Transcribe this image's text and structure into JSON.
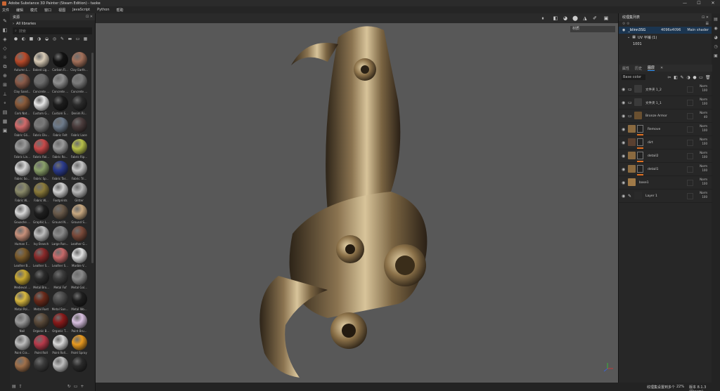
{
  "window": {
    "title": "Adobe Substance 3D Painter (Steam Edition) - taoke",
    "min": "—",
    "max": "☐",
    "close": "✕"
  },
  "menu": [
    "文件",
    "编辑",
    "模式",
    "窗口",
    "视图",
    "JavaScript",
    "Python",
    "帮助"
  ],
  "assets": {
    "title": "资源",
    "library": "All libraries",
    "search_placeholder": "搜索",
    "materials": [
      {
        "name": "Autumn L...",
        "color": "#b84a2a"
      },
      {
        "name": "Baked Lig...",
        "color": "#d8cbb6"
      },
      {
        "name": "Carbon Fi...",
        "color": "#121212"
      },
      {
        "name": "Clay Earth...",
        "color": "#a3705a"
      },
      {
        "name": "Clay Sand...",
        "color": "#8a5a48"
      },
      {
        "name": "Concrete ...",
        "color": "#6c6c6c"
      },
      {
        "name": "Concrete ...",
        "color": "#8f8f8f"
      },
      {
        "name": "Concrete ...",
        "color": "#7b7b7b"
      },
      {
        "name": "Cork Nat...",
        "color": "#8a5a3a"
      },
      {
        "name": "Custom G...",
        "color": "#e6e6e6"
      },
      {
        "name": "Custom S...",
        "color": "#1c1c1c"
      },
      {
        "name": "Denim Ri...",
        "color": "#2a2a2a"
      },
      {
        "name": "Fabric Gli...",
        "color": "#d26a6a"
      },
      {
        "name": "Fabric Div...",
        "color": "#7a7a7a"
      },
      {
        "name": "Fabric Felt",
        "color": "#6e7b8b"
      },
      {
        "name": "Fabric Lace",
        "color": "#4a3c3c"
      },
      {
        "name": "Fabric Lin...",
        "color": "#9a9a9a"
      },
      {
        "name": "Fabric Rol...",
        "color": "#c84a4a"
      },
      {
        "name": "Fabric Ro...",
        "color": "#9a9a9a"
      },
      {
        "name": "Fabric Rip...",
        "color": "#b8c04a"
      },
      {
        "name": "Fabric So...",
        "color": "#d6d6d6"
      },
      {
        "name": "Fabric Sp...",
        "color": "#8aa06a"
      },
      {
        "name": "Fabric Tar...",
        "color": "#2a3a8a"
      },
      {
        "name": "Fabric Tri...",
        "color": "#c6c6c6"
      },
      {
        "name": "Fabric W...",
        "color": "#8a8a6a"
      },
      {
        "name": "Fabric W...",
        "color": "#8a7a3a"
      },
      {
        "name": "Footprints",
        "color": "#cfcfcf"
      },
      {
        "name": "Glitter",
        "color": "#b8b8b8"
      },
      {
        "name": "Gouache ...",
        "color": "#d8d8d8"
      },
      {
        "name": "Graphic L...",
        "color": "#1e1e1e"
      },
      {
        "name": "Ground N...",
        "color": "#6a5a4a"
      },
      {
        "name": "Ground S...",
        "color": "#c8a880"
      },
      {
        "name": "Human F...",
        "color": "#c8907a"
      },
      {
        "name": "Ivy Branch",
        "color": "#bdbdbd"
      },
      {
        "name": "Large Ron...",
        "color": "#8a8a8a"
      },
      {
        "name": "Leather G...",
        "color": "#7a4a3a"
      },
      {
        "name": "Leather B...",
        "color": "#7a5a2a"
      },
      {
        "name": "Leather S...",
        "color": "#8a2a2a"
      },
      {
        "name": "Leather S...",
        "color": "#c86a6a"
      },
      {
        "name": "Marble V...",
        "color": "#e0e0e0"
      },
      {
        "name": "Medieval ...",
        "color": "#c8a830"
      },
      {
        "name": "Metal Bro...",
        "color": "#2a2a2a"
      },
      {
        "name": "Metal Fof",
        "color": "#3a3a3a"
      },
      {
        "name": "Metal Gal...",
        "color": "#8a8a8a"
      },
      {
        "name": "Metal Pol...",
        "color": "#d8b840"
      },
      {
        "name": "Metal Rust",
        "color": "#6a2a1a"
      },
      {
        "name": "Metal San...",
        "color": "#4a4a4a"
      },
      {
        "name": "Metal Wo...",
        "color": "#1e1e1e"
      },
      {
        "name": "Nail",
        "color": "#9a9a9a"
      },
      {
        "name": "Organic B...",
        "color": "#5a4a3a"
      },
      {
        "name": "Organic T...",
        "color": "#8a1a1a"
      },
      {
        "name": "Paint Bru...",
        "color": "#d8c0e0"
      },
      {
        "name": "Paint Cra...",
        "color": "#bdbdbd"
      },
      {
        "name": "Paint Roll",
        "color": "#b83a4a"
      },
      {
        "name": "Paint Roll...",
        "color": "#d8d8d8"
      },
      {
        "name": "Paint Spray",
        "color": "#e89a20"
      },
      {
        "name": "",
        "color": "#a0704a"
      },
      {
        "name": "",
        "color": "#3a3a3a"
      },
      {
        "name": "",
        "color": "#bfbfbf"
      },
      {
        "name": "",
        "color": "#2a2a2a"
      }
    ]
  },
  "viewport": {
    "material_mode": "材质",
    "status_left": "纹理集设置到多个",
    "status_zoom": "22%",
    "status_version": "版本 8.1.3 (Steam)"
  },
  "texture_sets": {
    "title": "纹理集列表",
    "items": [
      {
        "name": "_blinn3SG",
        "res": "4096x4096",
        "shader": "Main shader"
      }
    ],
    "uv_label": "UV 平铺 (1)",
    "uv_tile": "1001"
  },
  "layers_panel": {
    "tabs": [
      "图层",
      "历史",
      "属性"
    ],
    "blend_mode": "Base color",
    "layers": [
      {
        "name": "文件夹 1_2",
        "type": "folder",
        "mode": "Norm",
        "opacity": "100",
        "thumb": "#3a3a3a",
        "mask": false,
        "bar": false
      },
      {
        "name": "文件夹 1_1",
        "type": "folder",
        "mode": "Norm",
        "opacity": "100",
        "thumb": "#3a3a3a",
        "mask": false,
        "bar": false
      },
      {
        "name": "Bronze Armor",
        "type": "folder",
        "mode": "Norm",
        "opacity": "40",
        "thumb": "#6a5030",
        "mask": false,
        "bar": false
      },
      {
        "name": "Remove",
        "type": "fill",
        "mode": "Norm",
        "opacity": "100",
        "thumb": "#8a6a40",
        "mask": true,
        "bar": true
      },
      {
        "name": "dirt",
        "type": "fill",
        "mode": "Norm",
        "opacity": "100",
        "thumb": "#5a4030",
        "mask": true,
        "bar": true
      },
      {
        "name": "detail2",
        "type": "fill",
        "mode": "Norm",
        "opacity": "100",
        "thumb": "#8a6a40",
        "mask": true,
        "bar": true
      },
      {
        "name": "detail1",
        "type": "fill",
        "mode": "Norm",
        "opacity": "100",
        "thumb": "#8a6a40",
        "mask": true,
        "bar": true
      },
      {
        "name": "base1",
        "type": "fill",
        "mode": "Norm",
        "opacity": "100",
        "thumb": "#a07a48",
        "mask": false,
        "bar": false
      },
      {
        "name": "Layer 1",
        "type": "paint",
        "mode": "Norm",
        "opacity": "100",
        "thumb": "#2a2a2a",
        "mask": false,
        "bar": false
      }
    ]
  }
}
